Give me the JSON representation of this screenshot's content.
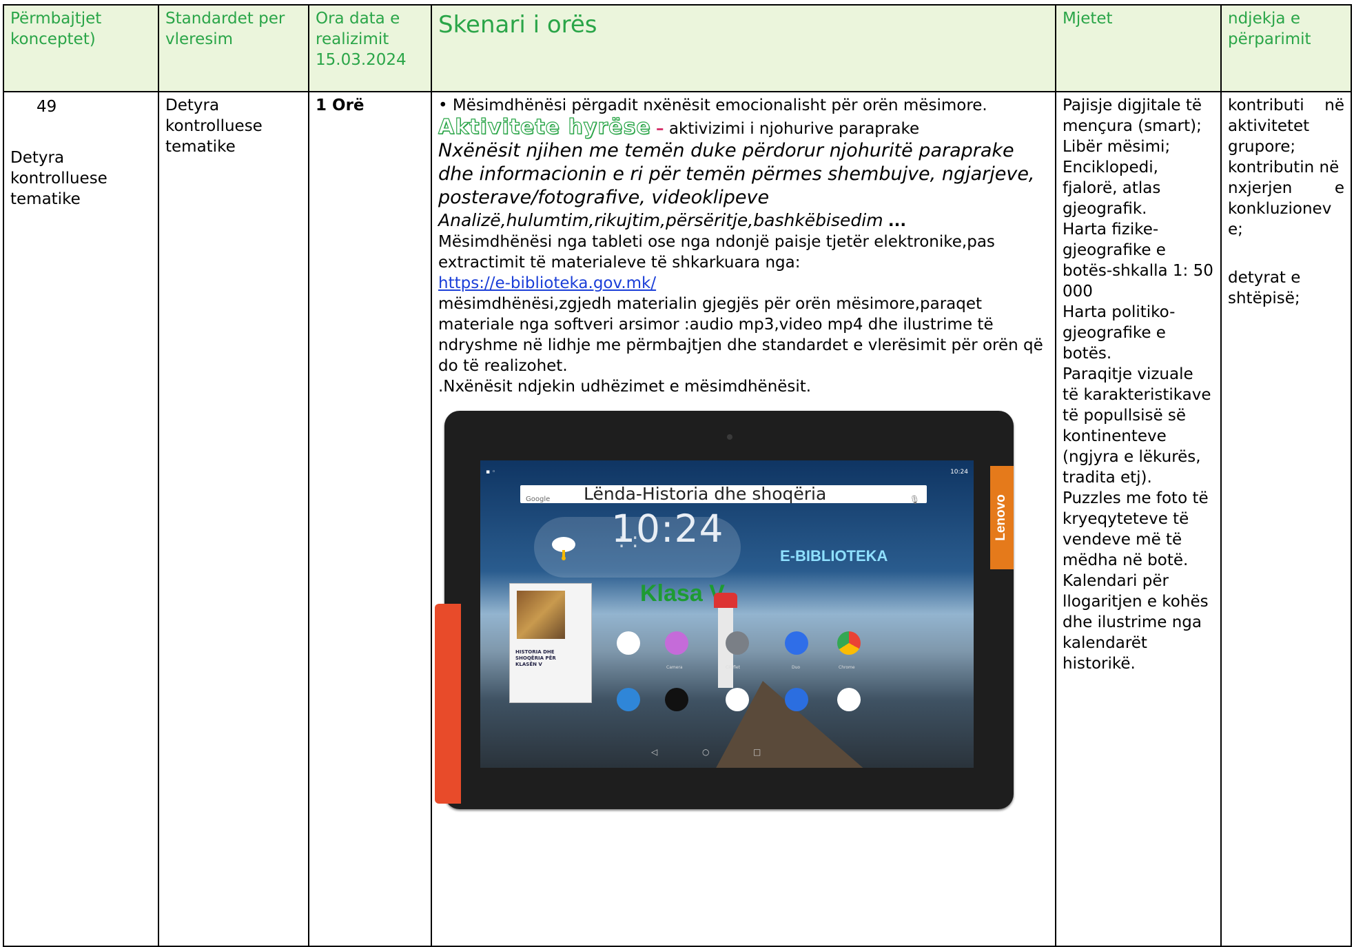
{
  "header": {
    "col1": "Përmbajtjet konceptet)",
    "col2": "Standardet per vleresim",
    "col3": "Ora data e realizimit 15.03.2024",
    "col4": "Skenari i orës",
    "col5": "Mjetet",
    "col6": "ndjekja e përparimit"
  },
  "row": {
    "num": "49",
    "topic": "Detyra kontrolluese tematike",
    "standard": "Detyra kontrolluese tematike",
    "duration": "1 Orë",
    "intro": "• Mësimdhënësi përgadit nxënësit emocionalisht për orën mësimore.",
    "activity_title": "Aktivitete hyrëse",
    "activity_dash": "–",
    "activity_sub": "aktivizimi i njohurive paraprake",
    "italic1": "Nxënësit njihen me temën duke përdorur njohuritë paraprake dhe informacionin e ri për temën përmes shembujve, ngjarjeve, posterave/fotografive, videoklipeve",
    "italic2": "Analizë,hulumtim,rikujtim,përsëritje,bashkëbisedim",
    "ellipsis": "...",
    "p1": "Mësimdhënësi nga tableti ose nga ndonjë paisje tjetër elektronike,pas extractimit të materialeve të shkarkuara nga:",
    "link": "https://e-biblioteka.gov.mk/",
    "p2": " mësimdhënësi,zgjedh materialin gjegjës për orën mësimore,paraqet materiale nga softveri arsimor :audio mp3,video mp4 dhe ilustrime të ndryshme në lidhje me përmbajtjen dhe standardet e vlerësimit për orën që do të realizohet.",
    "p3": ".Nxënësit ndjekin udhëzimet e mësimdhënësit.",
    "tools": [
      "Pajisje digjitale të mençura (smart);",
      "Libër mësimi;",
      "Enciklopedi, fjalorë, atlas gjeografik.",
      "Harta fizike-gjeografike e botës-shkalla 1: 50 000",
      "Harta politiko-gjeografike e botës.",
      "Paraqitje vizuale të karakteristikave të popullsisë së kontinenteve (ngjyra e lëkurës, tradita etj).",
      "Puzzles me foto të kryeqyteteve të vendeve më të mëdha në botë.",
      "Kalendari për llogaritjen e kohës dhe ilustrime nga kalendarët historikë."
    ],
    "progress_l1a": "kontributi",
    "progress_l1b": "në",
    "progress_l2": "aktivitetet grupore;",
    "progress_l3": "kontributin në",
    "progress_l4a": "nxjerjen",
    "progress_l4b": "e",
    "progress_l5": "konkluzionev e;",
    "progress_l6": "detyrat e shtëpisë;"
  },
  "tablet": {
    "search_brand": "Google",
    "search_text": "Lënda-Historia dhe shoqëria",
    "time": "10:24",
    "status_time": "10:24",
    "ebiblioteka": "E-BIBLIOTEKA",
    "klasa": "Klasa V",
    "book_title": "HISTORIA DHE SHOQËRIA PËR KLASËN V",
    "brand": "Lenovo",
    "apps": [
      "Camera",
      "Cili flet",
      "Duo",
      "Chrome"
    ]
  }
}
